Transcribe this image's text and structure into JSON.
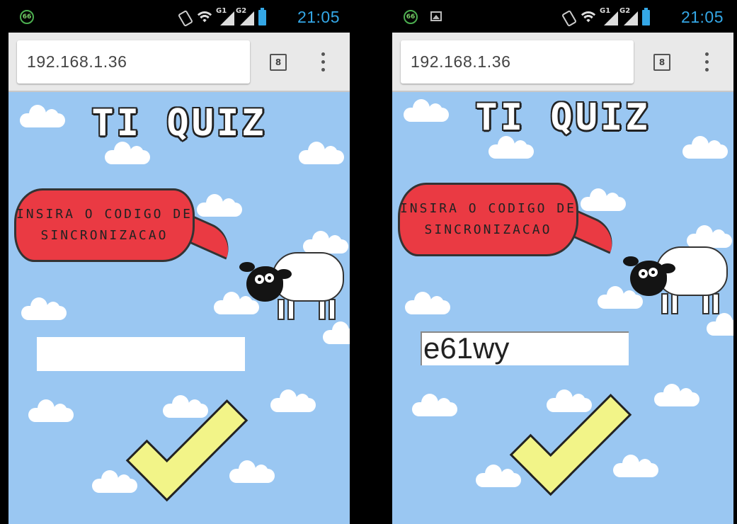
{
  "status_bar": {
    "badge_text": "66",
    "signal_labels": [
      "G1",
      "G2"
    ],
    "time": "21:05",
    "time_color": "#34a7e6"
  },
  "browser": {
    "url": "192.168.1.36",
    "tab_count": "8",
    "menu_icon": "overflow-menu-icon"
  },
  "app": {
    "title": "TI QUIZ",
    "prompt_line1": "INSIRA O CODIGO DE",
    "prompt_line2": "SINCRONIZACAO",
    "bubble_color": "#ea3a43",
    "sky_color": "#9ac7f2",
    "submit_color": "#f2f488",
    "submit_icon": "checkmark-icon",
    "mascot_icon": "sheep-icon"
  },
  "screens": {
    "left": {
      "code_value": ""
    },
    "right": {
      "code_value": "e61wy"
    }
  }
}
